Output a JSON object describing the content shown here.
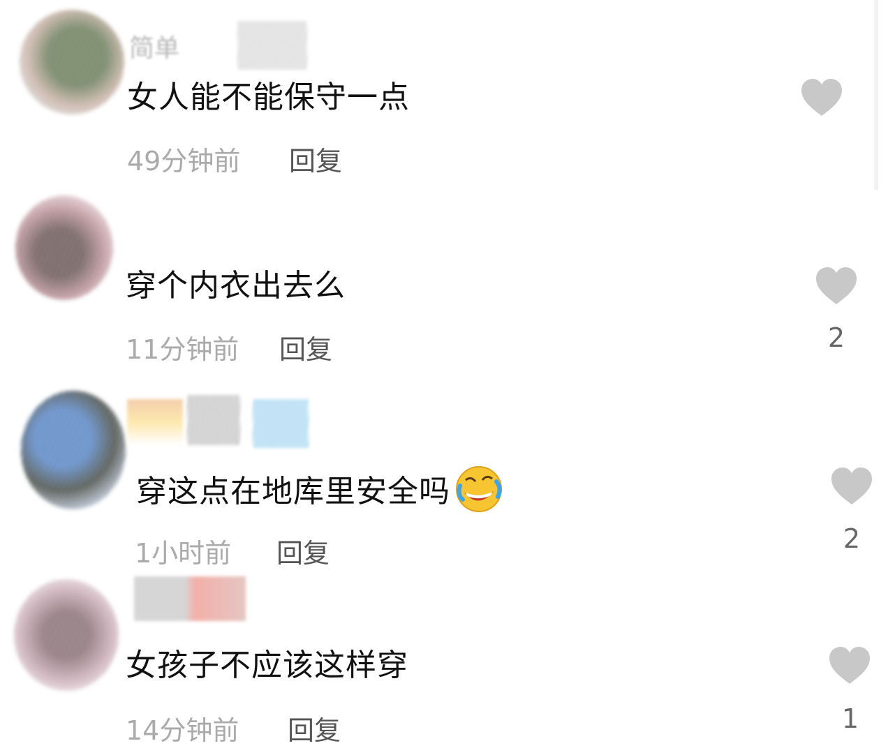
{
  "comments": [
    {
      "username": "简单",
      "text": "女人能不能保守一点",
      "time": "49分钟前",
      "reply_label": "回复",
      "likes": "",
      "avatar_colors": [
        "#6d7f5d",
        "#c9b3a8"
      ]
    },
    {
      "username": "",
      "text": "穿个内衣出去么",
      "time": "11分钟前",
      "reply_label": "回复",
      "likes": "2",
      "avatar_colors": [
        "#6e5a5a",
        "#d8a7b0"
      ]
    },
    {
      "username": "",
      "text": "穿这点在地库里安全吗",
      "time": "1小时前",
      "reply_label": "回复",
      "likes": "2",
      "emoji": "rofl-emoji",
      "avatar_colors": [
        "#5b87c5",
        "#4a4f4a"
      ]
    },
    {
      "username": "",
      "text": "女孩子不应该这样穿",
      "time": "14分钟前",
      "reply_label": "回复",
      "likes": "1",
      "avatar_colors": [
        "#8a7378",
        "#c9aab5"
      ]
    }
  ],
  "colors": {
    "heart": "#c8c8c8",
    "time": "#aaaaaa",
    "reply": "#555555",
    "text": "#111111"
  }
}
